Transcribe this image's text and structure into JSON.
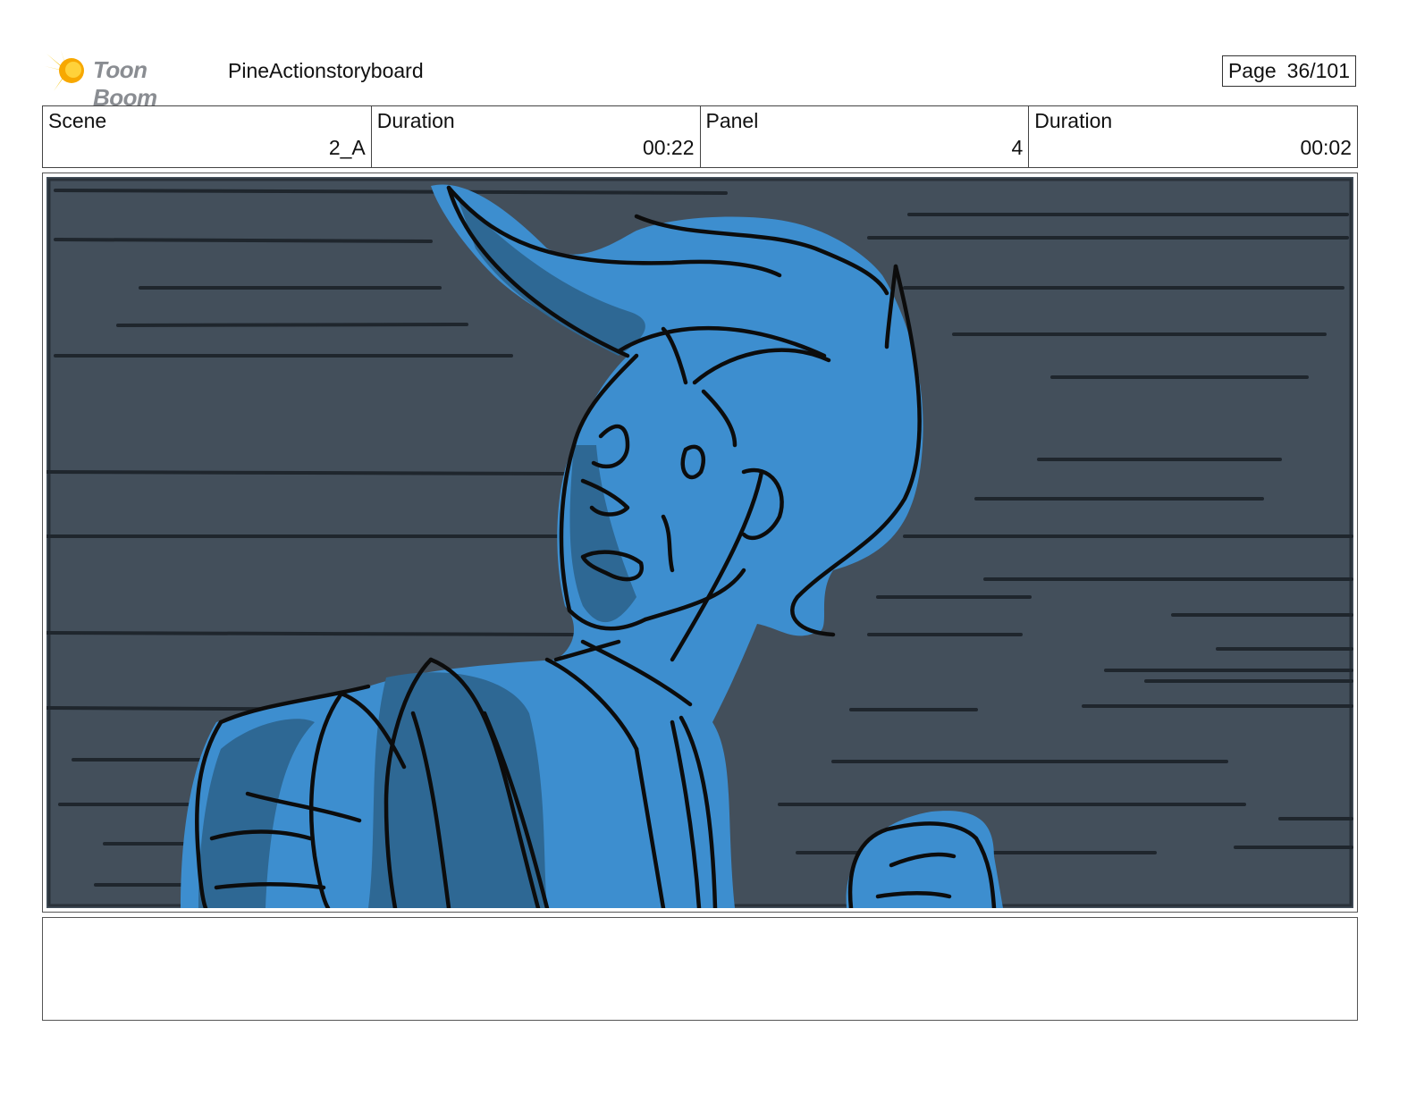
{
  "header": {
    "logo_text": "Toon Boom",
    "project_title": "PineActionstoryboard",
    "page_label": "Page",
    "page_value": "36/101"
  },
  "info": {
    "scene_label": "Scene",
    "scene_value": "2_A",
    "scene_duration_label": "Duration",
    "scene_duration_value": "00:22",
    "panel_label": "Panel",
    "panel_value": "4",
    "panel_duration_label": "Duration",
    "panel_duration_value": "00:02"
  },
  "panel": {
    "background_color": "#434f5b",
    "figure_color": "#3d8ecf",
    "shadow_color": "#2e6894",
    "line_color": "#0c0c0c"
  },
  "notes": {
    "text": ""
  }
}
